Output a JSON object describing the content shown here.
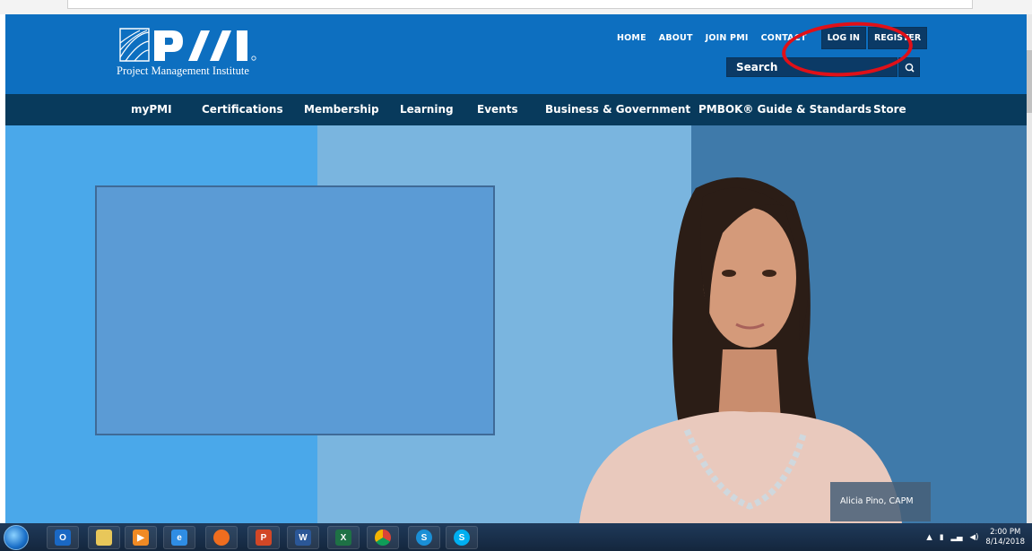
{
  "logo": {
    "org_name": "Project Management Institute",
    "mark": "PMI"
  },
  "top_nav": {
    "links": [
      "HOME",
      "ABOUT",
      "JOIN PMI",
      "CONTACT"
    ],
    "login_label": "LOG IN",
    "register_label": "REGISTER"
  },
  "search": {
    "placeholder": "Search"
  },
  "main_nav": {
    "items": [
      "myPMI",
      "Certifications",
      "Membership",
      "Learning",
      "Events",
      "Business & Government",
      "PMBOK® Guide & Standards",
      "Store"
    ]
  },
  "hero": {
    "caption": "Alicia Pino, CAPM"
  },
  "taskbar": {
    "icons": [
      "windows-start",
      "outlook",
      "file-explorer",
      "media-player",
      "internet-explorer",
      "firefox",
      "powerpoint",
      "word",
      "excel",
      "chrome",
      "skype-for-business",
      "skype"
    ],
    "time": "2:00 PM",
    "date": "8/14/2018"
  },
  "colors": {
    "header_blue": "#0d6fc0",
    "nav_dark": "#083a5c",
    "button_dark": "#0b3a66",
    "highlight_red": "#e01018"
  }
}
